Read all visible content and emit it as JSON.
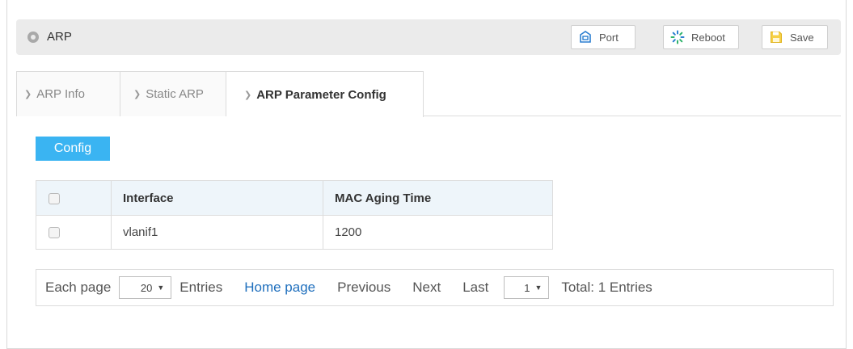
{
  "header": {
    "title": "ARP",
    "buttons": {
      "port": "Port",
      "reboot": "Reboot",
      "save": "Save"
    }
  },
  "tabs": [
    {
      "label": "ARP Info",
      "active": false
    },
    {
      "label": "Static ARP",
      "active": false
    },
    {
      "label": "ARP Parameter Config",
      "active": true
    }
  ],
  "config_button": "Config",
  "table": {
    "columns": [
      "Interface",
      "MAC Aging Time"
    ],
    "rows": [
      {
        "interface": "vlanif1",
        "mac_aging_time": "1200"
      }
    ]
  },
  "pager": {
    "each_page_label": "Each page",
    "page_size": "20",
    "entries_label": "Entries",
    "home_page": "Home page",
    "previous": "Previous",
    "next": "Next",
    "last": "Last",
    "current_page": "1",
    "total": "Total: 1 Entries"
  },
  "colors": {
    "accent": "#3ab4f2",
    "link": "#1f6fbd",
    "header_bg": "#ebebeb",
    "table_head_bg": "#eef5fa"
  }
}
